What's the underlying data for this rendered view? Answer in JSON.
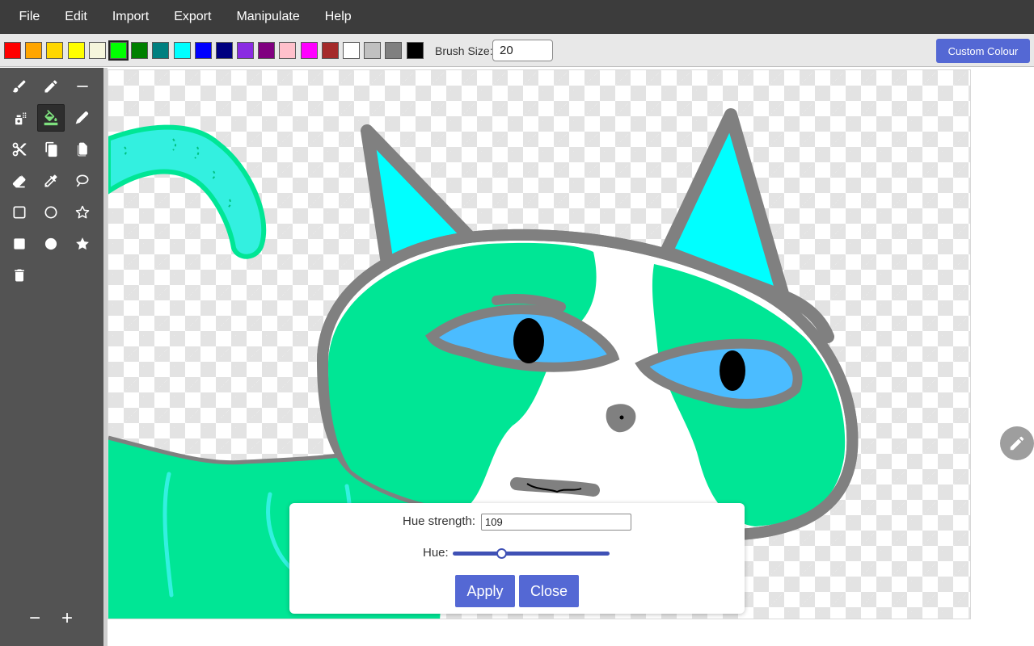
{
  "menu": [
    "File",
    "Edit",
    "Import",
    "Export",
    "Manipulate",
    "Help"
  ],
  "palette": {
    "colors": [
      "#ff0000",
      "#ffa500",
      "#ffd700",
      "#ffff00",
      "#f5f5dc",
      "#00ff00",
      "#008000",
      "#008080",
      "#00ffff",
      "#0000ff",
      "#000080",
      "#8a2be2",
      "#800080",
      "#ffc0cb",
      "#ff00ff",
      "#a52a2a",
      "#ffffff",
      "#c0c0c0",
      "#808080",
      "#000000"
    ],
    "selected_index": 5,
    "brush_size_label": "Brush Size:",
    "brush_size_value": "20",
    "custom_colour_label": "Custom Colour"
  },
  "tools": [
    {
      "name": "brush-tool",
      "icon": "brush-icon"
    },
    {
      "name": "pencil-tool",
      "icon": "pencil-icon"
    },
    {
      "name": "line-tool",
      "icon": "line-icon"
    },
    {
      "name": "spray-tool",
      "icon": "spray-can-icon"
    },
    {
      "name": "fill-tool",
      "icon": "paint-bucket-icon",
      "active": true
    },
    {
      "name": "pen-tool",
      "icon": "pen-icon"
    },
    {
      "name": "cut-tool",
      "icon": "scissors-icon"
    },
    {
      "name": "copy-tool",
      "icon": "copy-icon"
    },
    {
      "name": "paste-tool",
      "icon": "paste-icon"
    },
    {
      "name": "eraser-tool",
      "icon": "eraser-icon"
    },
    {
      "name": "eyedropper-tool",
      "icon": "eyedropper-icon"
    },
    {
      "name": "lasso-tool",
      "icon": "lasso-icon"
    },
    {
      "name": "rectangle-outline-tool",
      "icon": "rectangle-outline-icon"
    },
    {
      "name": "circle-outline-tool",
      "icon": "circle-outline-icon"
    },
    {
      "name": "star-outline-tool",
      "icon": "star-outline-icon"
    },
    {
      "name": "rectangle-filled-tool",
      "icon": "rectangle-filled-icon"
    },
    {
      "name": "circle-filled-tool",
      "icon": "circle-filled-icon"
    },
    {
      "name": "star-filled-tool",
      "icon": "star-filled-icon"
    },
    {
      "name": "clear-tool",
      "icon": "trash-icon"
    }
  ],
  "zoom": {
    "out_label": "−",
    "in_label": "+"
  },
  "hue_dialog": {
    "strength_label": "Hue strength:",
    "strength_value": "109",
    "hue_label": "Hue:",
    "hue_slider_fraction": 0.31,
    "apply_label": "Apply",
    "close_label": "Close"
  },
  "colors": {
    "accent": "#5468d4",
    "menubar": "#3c3c3c",
    "toolbar": "#535353",
    "drawing_green": "#00e695",
    "drawing_outline": "#808080",
    "drawing_cyan": "#00ffff",
    "drawing_eye_blue": "#4bbcff"
  },
  "floating_button_icon": "pencil-icon"
}
